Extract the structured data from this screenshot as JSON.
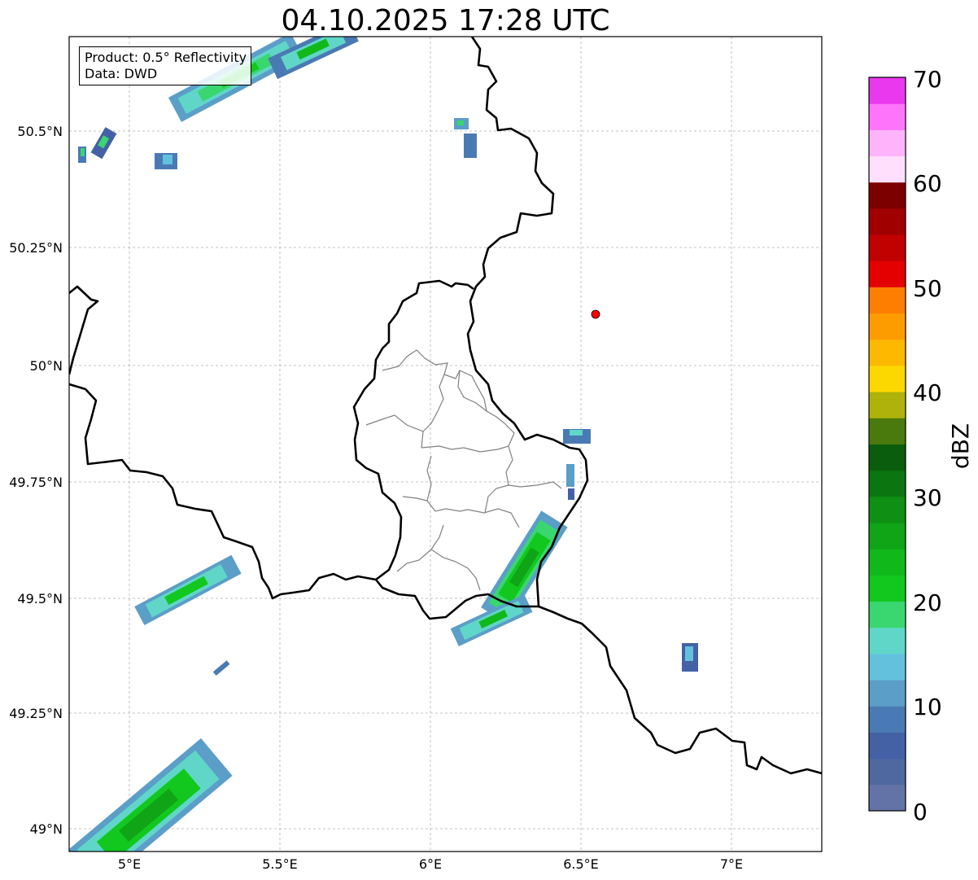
{
  "title": "04.10.2025 17:28 UTC",
  "info_box": {
    "line1": "Product: 0.5° Reflectivity",
    "line2": "Data: DWD"
  },
  "map": {
    "lon_range": [
      4.8,
      7.3
    ],
    "lat_range": [
      48.95,
      50.7
    ],
    "x_ticks": [
      "5°E",
      "5.5°E",
      "6°E",
      "6.5°E",
      "7°E"
    ],
    "y_ticks": [
      "50.5°N",
      "50.25°N",
      "50°N",
      "49.75°N",
      "49.5°N",
      "49.25°N",
      "49°N"
    ],
    "gridlines": true,
    "marker": {
      "label": "radar-site",
      "lon": 6.55,
      "lat": 50.11,
      "color": "#ff0000"
    }
  },
  "colorbar": {
    "label": "dBZ",
    "ticks": [
      "0",
      "10",
      "20",
      "30",
      "40",
      "50",
      "60",
      "70"
    ],
    "colors": [
      "#6473a6",
      "#5068a0",
      "#4461a6",
      "#4a7ab3",
      "#5b9ec8",
      "#63c1dd",
      "#60d6c8",
      "#3ad670",
      "#12c81e",
      "#11b81a",
      "#10a417",
      "#0f8f14",
      "#0b7610",
      "#0a5d0c",
      "#4a7a0e",
      "#aeb20a",
      "#fdd800",
      "#fdb800",
      "#fd9c00",
      "#fd7e00",
      "#e50000",
      "#c10000",
      "#a10000",
      "#7d0000",
      "#ffdffb",
      "#feb4fb",
      "#fe75f9",
      "#ea38ee"
    ]
  }
}
